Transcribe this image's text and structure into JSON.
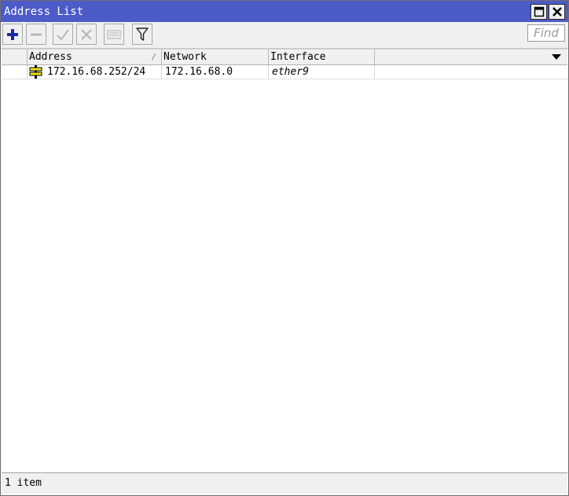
{
  "window": {
    "title": "Address List"
  },
  "toolbar": {
    "find_placeholder": "Find",
    "icons": [
      "plus-icon",
      "minus-icon",
      "check-icon",
      "x-icon",
      "note-icon",
      "filter-icon"
    ]
  },
  "columns": [
    {
      "label": "Address",
      "sort": "/"
    },
    {
      "label": "Network"
    },
    {
      "label": "Interface"
    }
  ],
  "rows": [
    {
      "address": "172.16.68.252/24",
      "network": "172.16.68.0",
      "interface": "ether9"
    }
  ],
  "status": {
    "text": "1 item"
  },
  "colors": {
    "titlebar": "#4d5bc8",
    "add_icon": "#1a2aa0"
  }
}
